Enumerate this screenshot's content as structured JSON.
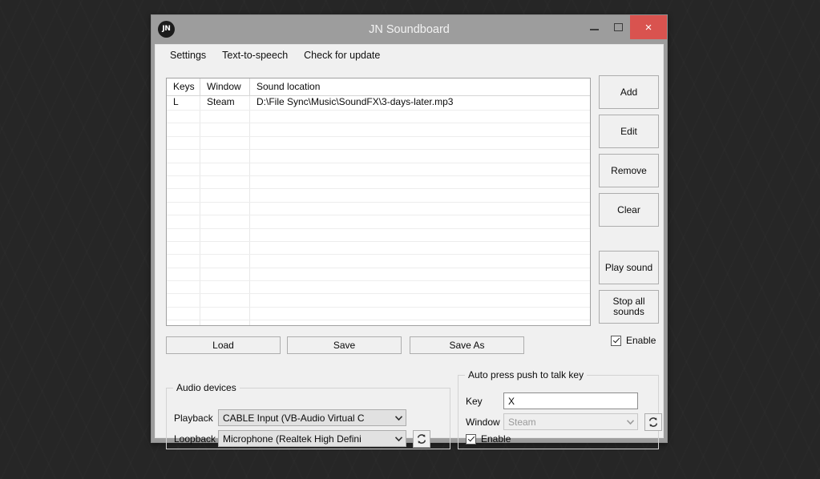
{
  "window": {
    "title": "JN Soundboard",
    "icon": "jn-logo-icon",
    "icon_text": "JN",
    "minimize_label": "–",
    "maximize_label": "☐",
    "close_label": "×"
  },
  "menubar": {
    "items": [
      {
        "label": "Settings"
      },
      {
        "label": "Text-to-speech"
      },
      {
        "label": "Check for update"
      }
    ]
  },
  "soundlist": {
    "columns": [
      "Keys",
      "Window",
      "Sound location"
    ],
    "rows": [
      {
        "keys": "L",
        "window": "Steam",
        "location": "D:\\File Sync\\Music\\SoundFX\\3-days-later.mp3"
      }
    ],
    "empty_row_count": 19
  },
  "side_buttons": {
    "add": "Add",
    "edit": "Edit",
    "remove": "Remove",
    "clear": "Clear",
    "play_sound": "Play sound",
    "stop_all_sounds": "Stop all\nsounds"
  },
  "file_buttons": {
    "load": "Load",
    "save": "Save",
    "save_as": "Save As"
  },
  "enable_checkbox": {
    "label": "Enable",
    "checked": true
  },
  "audio_devices": {
    "title": "Audio devices",
    "playback_label": "Playback",
    "playback_value": "CABLE Input (VB-Audio Virtual C",
    "loopback_label": "Loopback",
    "loopback_value": "Microphone (Realtek High Defini",
    "refresh_icon": "refresh-icon"
  },
  "push_to_talk": {
    "title": "Auto press push to talk key",
    "key_label": "Key",
    "key_value": "X",
    "window_label": "Window",
    "window_value": "Steam",
    "window_disabled": true,
    "enable_label": "Enable",
    "enable_checked": true,
    "refresh_icon": "refresh-icon"
  },
  "colors": {
    "desktop": "#262626",
    "titlebar": "#9d9d9d",
    "client": "#f0f0f0",
    "close_button": "#d9534f",
    "list_background": "#ffffff"
  }
}
